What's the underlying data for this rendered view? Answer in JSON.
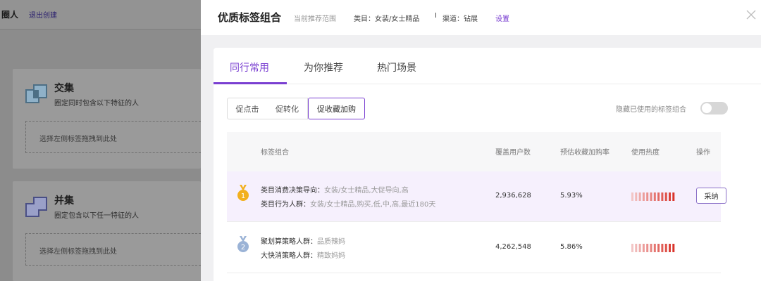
{
  "background": {
    "title": "圈人",
    "exit_link": "退出创建",
    "panels": [
      {
        "title": "交集",
        "subtitle": "圈定同时包含以下特征的人",
        "drop_hint": "选择左侧标签拖拽到此处"
      },
      {
        "title": "并集",
        "subtitle": "圈定包含以下任一特征的人",
        "drop_hint": "选择左侧标签拖拽到此处"
      }
    ]
  },
  "drawer": {
    "title": "优质标签组合",
    "range_label": "当前推荐范围",
    "category": "类目：女装/女士精品",
    "separator": "I",
    "channel": "渠道：钻展",
    "settings_link": "设置",
    "tabs": [
      "同行常用",
      "为你推荐",
      "热门场景"
    ],
    "active_tab": 0,
    "segments": [
      "促点击",
      "促转化",
      "促收藏加购"
    ],
    "active_segment": 2,
    "hide_used_label": "隐藏已使用的标签组合",
    "hide_used_on": false,
    "table": {
      "headers": [
        "标签组合",
        "覆盖用户数",
        "预估收藏加购率",
        "使用热度",
        "操作"
      ],
      "rows": [
        {
          "rank": 1,
          "tags": [
            {
              "name": "类目消费决策导向：",
              "value": "女装/女士精品,大促导向,高"
            },
            {
              "name": "类目行为人群：",
              "value": "女装/女士精品,购买,低,中,高,最近180天"
            }
          ],
          "users": "2,936,628",
          "rate": "5.93%",
          "heat_level": 1.0,
          "action": "采纳"
        },
        {
          "rank": 2,
          "tags": [
            {
              "name": "聚划算策略人群：",
              "value": "品质辣妈"
            },
            {
              "name": "大快消策略人群：",
              "value": "精致妈妈"
            }
          ],
          "users": "4,262,548",
          "rate": "5.86%",
          "heat_level": 1.0,
          "action": ""
        }
      ]
    }
  },
  "colors": {
    "accent": "#7a3fd1",
    "heat_dark": "#d9342b",
    "heat_light": "#f3c6c6",
    "gold_medal": "#f2b01e",
    "silver_medal": "#9bb3d6"
  }
}
